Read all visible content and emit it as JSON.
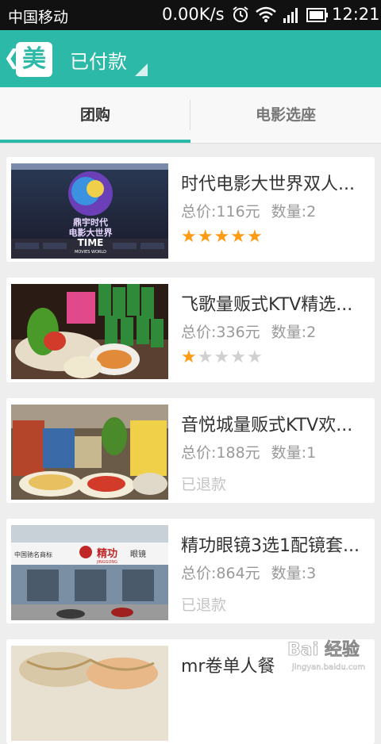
{
  "status_bar": {
    "carrier": "中国移动",
    "speed": "0.00K/s",
    "time": "12:21",
    "icons": [
      "alarm-icon",
      "wifi-icon",
      "signal-icon",
      "battery-icon"
    ]
  },
  "header": {
    "logo_text": "美",
    "title": "已付款",
    "icons": [
      "back-icon",
      "dropdown-icon"
    ]
  },
  "tabs": [
    {
      "label": "团购",
      "active": true
    },
    {
      "label": "电影选座",
      "active": false
    }
  ],
  "orders": [
    {
      "title": "时代电影大世界双人...",
      "total": "总价:116元",
      "quantity": "数量:2",
      "rating": 5,
      "status": ""
    },
    {
      "title": "飞歌量贩式KTV精选...",
      "total": "总价:336元",
      "quantity": "数量:2",
      "rating": 1,
      "status": ""
    },
    {
      "title": "音悦城量贩式KTV欢...",
      "total": "总价:188元",
      "quantity": "数量:1",
      "rating": null,
      "status": "已退款"
    },
    {
      "title": "精功眼镜3选1配镜套...",
      "total": "总价:864元",
      "quantity": "数量:3",
      "rating": null,
      "status": "已退款"
    },
    {
      "title": "mr卷单人餐",
      "total": "",
      "quantity": "",
      "rating": null,
      "status": ""
    }
  ],
  "thumbnails": {
    "cinema_logo_line1": "鼎宇时代",
    "cinema_logo_line2": "电影大世界",
    "cinema_logo_line3": "TIME",
    "cinema_logo_line4": "MOVIES WORLD",
    "shop_sign_1": "中国驰名商标",
    "shop_sign_2": "精功",
    "shop_sign_3": "JINGGONG",
    "shop_sign_4": "眼镜"
  },
  "watermark": {
    "text": "Bai 经验",
    "subtext": "jingyan.baidu.com"
  },
  "colors": {
    "accent": "#2db9a8",
    "star": "#ff9b12",
    "star_off": "#d0d0d0"
  }
}
